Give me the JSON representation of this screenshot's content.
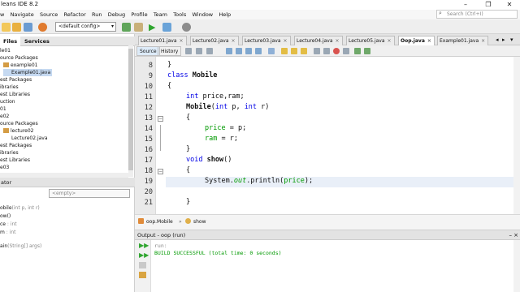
{
  "window": {
    "title": "leans IDE 8.2"
  },
  "menu": [
    "w",
    "Navigate",
    "Source",
    "Refactor",
    "Run",
    "Debug",
    "Profile",
    "Team",
    "Tools",
    "Window",
    "Help"
  ],
  "toolbar": {
    "config_value": "<default config>"
  },
  "search": {
    "placeholder": "Search (Ctrl+I)"
  },
  "projects": {
    "tabs": [
      "Files",
      "Services"
    ],
    "tree": [
      "le01",
      "ource Packages",
      "example01",
      "Example01.java",
      "est Packages",
      "ibraries",
      "est Libraries",
      "uction",
      "01",
      "e02",
      "ource Packages",
      "lecture02",
      "Lecture02.java",
      "est Packages",
      "ibraries",
      "est Libraries",
      "e03"
    ]
  },
  "navigator": {
    "title": "ator",
    "selector": "<empty>",
    "items": [
      {
        "name": "obile",
        "detail": "(int p, int r)"
      },
      {
        "name": "ow()",
        "detail": ""
      },
      {
        "name": "ce",
        "detail": " : int"
      },
      {
        "name": "m",
        "detail": " : int"
      },
      {
        "name": "ain",
        "detail": "(String[] args)"
      }
    ]
  },
  "editor": {
    "tabs": [
      "Lecture01.java",
      "Lecture02.java",
      "Lecture03.java",
      "Lecture04.java",
      "Lecture05.java",
      "Oop.java",
      "Example01.java"
    ],
    "active_tab": "Oop.java",
    "view_buttons": [
      "Source",
      "History"
    ],
    "line_numbers": [
      "8",
      "9",
      "10",
      "11",
      "12",
      "13",
      "14",
      "15",
      "16",
      "17",
      "18",
      "19",
      "20",
      "21"
    ],
    "code": {
      "l8": "}",
      "l9_kw": "class",
      "l9_name": "Mobile",
      "l10": "{",
      "l11_kw": "int",
      "l11_rest": "price,ram;",
      "l12_name": "Mobile",
      "l12_open": "(",
      "l12_kw1": "int",
      "l12_p": " p, ",
      "l12_kw2": "int",
      "l12_r": " r)",
      "l13": "{",
      "l14_field": "price",
      "l14_rest": " = p;",
      "l15_field": "ram",
      "l15_rest": " = r;",
      "l16": "}",
      "l17_kw": "void",
      "l17_name": "show",
      "l17_rest": "()",
      "l18": "{",
      "l19_a": "System.",
      "l19_out": "out",
      "l19_b": ".println(",
      "l19_field": "price",
      "l19_c": ");",
      "l21": "}"
    }
  },
  "breadcrumbs": [
    "oop.Mobile",
    "show"
  ],
  "output": {
    "title": "Output - oop (run)",
    "lines": [
      "run:",
      "BUILD SUCCESSFUL (total time: 0 seconds)"
    ]
  },
  "colors": {
    "keyword": "#0000e6",
    "field": "#009900",
    "build_success": "#009900",
    "current_line": "#e9eff8"
  }
}
